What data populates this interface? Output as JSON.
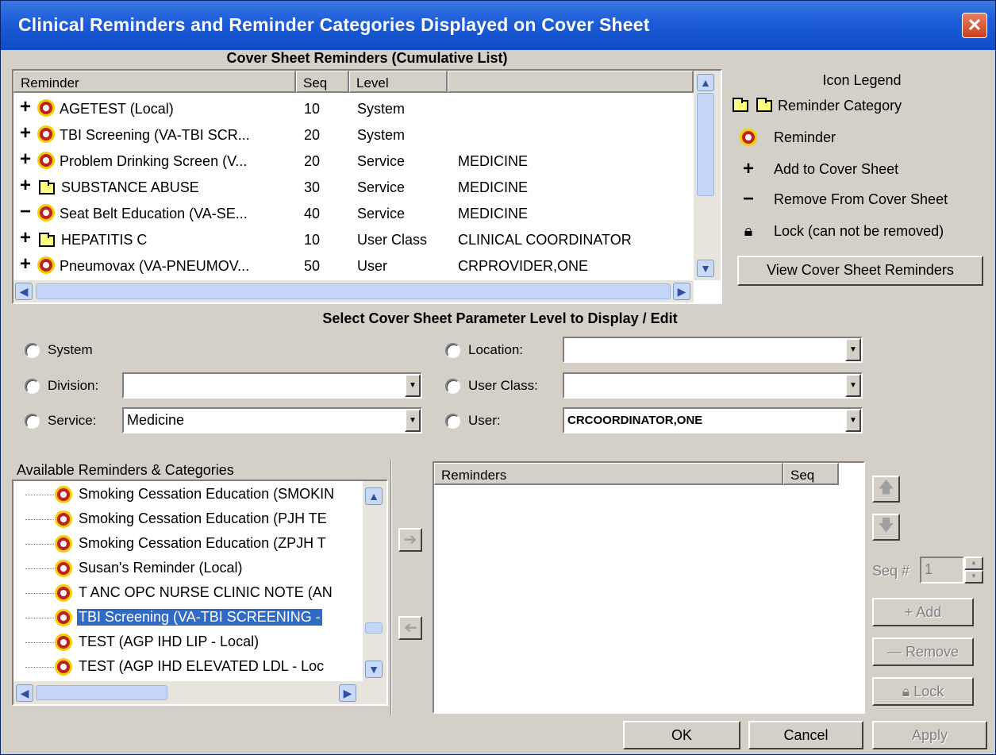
{
  "window": {
    "title": "Clinical Reminders and Reminder Categories Displayed on Cover Sheet"
  },
  "cover_sheet": {
    "heading": "Cover Sheet Reminders (Cumulative List)",
    "columns": [
      "Reminder",
      "Seq",
      "Level",
      ""
    ],
    "rows": [
      {
        "action": "+",
        "icon": "reminder-icon",
        "reminder": "AGETEST (Local)",
        "seq": "10",
        "level": "System",
        "value": ""
      },
      {
        "action": "+",
        "icon": "reminder-icon",
        "reminder": "TBI Screening (VA-TBI SCR...",
        "seq": "20",
        "level": "System",
        "value": ""
      },
      {
        "action": "+",
        "icon": "reminder-icon",
        "reminder": "Problem Drinking Screen (V...",
        "seq": "20",
        "level": "Service",
        "value": "MEDICINE"
      },
      {
        "action": "+",
        "icon": "folder-icon",
        "reminder": "SUBSTANCE ABUSE",
        "seq": "30",
        "level": "Service",
        "value": "MEDICINE"
      },
      {
        "action": "−",
        "icon": "reminder-icon",
        "reminder": "Seat Belt Education (VA-SE...",
        "seq": "40",
        "level": "Service",
        "value": "MEDICINE"
      },
      {
        "action": "+",
        "icon": "folder-icon",
        "reminder": "HEPATITIS C",
        "seq": "10",
        "level": "User Class",
        "value": "CLINICAL COORDINATOR"
      },
      {
        "action": "+",
        "icon": "reminder-icon",
        "reminder": "Pneumovax (VA-PNEUMOV...",
        "seq": "50",
        "level": "User",
        "value": "CRPROVIDER,ONE"
      }
    ]
  },
  "legend": {
    "title": "Icon Legend",
    "items": [
      {
        "icon": "folder-icon",
        "label": "Reminder Category"
      },
      {
        "icon": "reminder-icon",
        "label": "Reminder"
      },
      {
        "icon": "plus-icon",
        "label": "Add to Cover Sheet"
      },
      {
        "icon": "minus-icon",
        "label": "Remove From Cover Sheet"
      },
      {
        "icon": "lock-icon",
        "label": "Lock (can not be removed)"
      }
    ],
    "view_button": "View Cover Sheet Reminders"
  },
  "param_level": {
    "heading": "Select Cover Sheet Parameter Level to Display / Edit",
    "system": "System",
    "division": {
      "label": "Division:",
      "value": ""
    },
    "service": {
      "label": "Service:",
      "value": "Medicine"
    },
    "location": {
      "label": "Location:",
      "value": ""
    },
    "user_class": {
      "label": "User Class:",
      "value": ""
    },
    "user": {
      "label": "User:",
      "value": "CRCOORDINATOR,ONE"
    }
  },
  "available": {
    "label": "Available Reminders & Categories",
    "items": [
      "Smoking Cessation Education (SMOKIN",
      "Smoking Cessation Education (PJH TE",
      "Smoking Cessation Education (ZPJH T",
      "Susan's Reminder (Local)",
      "T ANC OPC NURSE CLINIC NOTE (AN",
      "TBI Screening (VA-TBI SCREENING -",
      "TEST (AGP IHD LIP - Local)",
      "TEST (AGP IHD ELEVATED LDL - Loc"
    ],
    "selected_index": 5
  },
  "reminders_list": {
    "columns": [
      "Reminders",
      "Seq"
    ]
  },
  "controls": {
    "seq_label": "Seq #",
    "seq_value": "1",
    "add": "Add",
    "remove": "Remove",
    "lock": "Lock"
  },
  "footer": {
    "ok": "OK",
    "cancel": "Cancel",
    "apply": "Apply"
  }
}
